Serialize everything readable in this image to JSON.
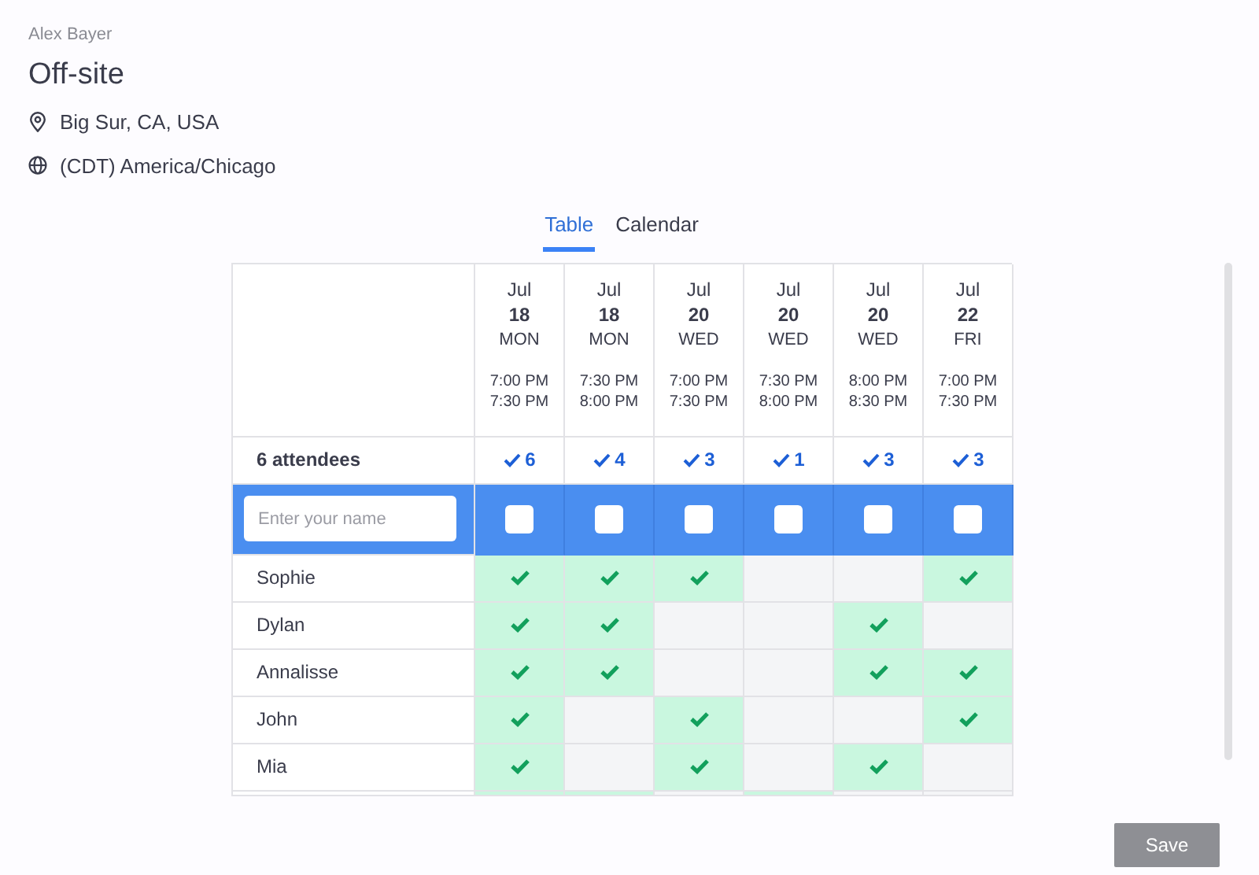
{
  "organizer": "Alex Bayer",
  "title": "Off-site",
  "location": "Big Sur, CA, USA",
  "timezone": "(CDT) America/Chicago",
  "tabs": [
    {
      "label": "Table",
      "selected": true
    },
    {
      "label": "Calendar",
      "selected": false
    }
  ],
  "table": {
    "attendee_count": "6 attendees",
    "name_field": {
      "placeholder": "Enter your name"
    },
    "columns": [
      {
        "month": "Jul",
        "day": "18",
        "weekday": "MON",
        "start": "7:00 PM",
        "end": "7:30 PM",
        "count": "6",
        "checked": false
      },
      {
        "month": "Jul",
        "day": "18",
        "weekday": "MON",
        "start": "7:30 PM",
        "end": "8:00 PM",
        "count": "4",
        "checked": false
      },
      {
        "month": "Jul",
        "day": "20",
        "weekday": "WED",
        "start": "7:00 PM",
        "end": "7:30 PM",
        "count": "3",
        "checked": false
      },
      {
        "month": "Jul",
        "day": "20",
        "weekday": "WED",
        "start": "7:30 PM",
        "end": "8:00 PM",
        "count": "1",
        "checked": false
      },
      {
        "month": "Jul",
        "day": "20",
        "weekday": "WED",
        "start": "8:00 PM",
        "end": "8:30 PM",
        "count": "3",
        "checked": false
      },
      {
        "month": "Jul",
        "day": "22",
        "weekday": "FRI",
        "start": "7:00 PM",
        "end": "7:30 PM",
        "count": "3",
        "checked": false
      }
    ],
    "rows": [
      {
        "name": "Sophie",
        "available": [
          true,
          true,
          true,
          false,
          false,
          true
        ]
      },
      {
        "name": "Dylan",
        "available": [
          true,
          true,
          false,
          false,
          true,
          false
        ]
      },
      {
        "name": "Annalisse",
        "available": [
          true,
          true,
          false,
          false,
          true,
          true
        ]
      },
      {
        "name": "John",
        "available": [
          true,
          false,
          true,
          false,
          false,
          true
        ]
      },
      {
        "name": "Mia",
        "available": [
          true,
          false,
          true,
          false,
          true,
          false
        ]
      },
      {
        "available": [
          true,
          true,
          false,
          true,
          false,
          false
        ]
      }
    ]
  },
  "save_button": "Save"
}
